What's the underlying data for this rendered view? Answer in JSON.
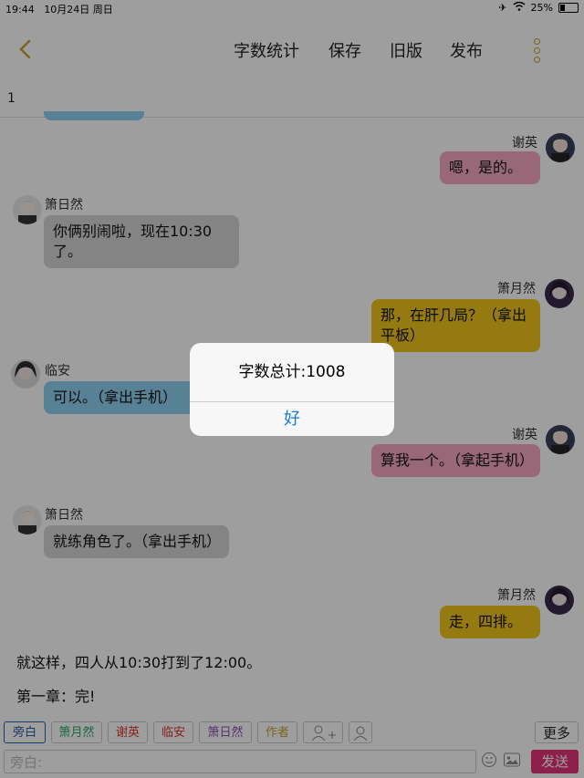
{
  "status_bar": {
    "time": "19:44",
    "date": "10月24日 周日",
    "battery": "25%",
    "battery_level": 0.25
  },
  "nav": {
    "word_count": "字数统计",
    "save": "保存",
    "old_version": "旧版",
    "publish": "发布"
  },
  "page_number": "1",
  "messages": [
    {
      "name": "谢英",
      "text": "嗯，是的。",
      "side": "right",
      "color": "#f5a8c2"
    },
    {
      "name": "箫日然",
      "text": "你俩别闹啦，现在10:30了。",
      "side": "left",
      "color": "#d6d6d6"
    },
    {
      "name": "箫月然",
      "text": "那，在肝几局？（拿出平板）",
      "side": "right",
      "color": "#f0c51c"
    },
    {
      "name": "临安",
      "text": "可以。（拿出手机）",
      "side": "left",
      "color": "#8fd0f2"
    },
    {
      "name": "谢英",
      "text": "算我一个。（拿起手机）",
      "side": "right",
      "color": "#f5a8c2"
    },
    {
      "name": "箫日然",
      "text": "就练角色了。（拿出手机）",
      "side": "left",
      "color": "#d6d6d6"
    },
    {
      "name": "箫月然",
      "text": "走，四排。",
      "side": "right",
      "color": "#f0c51c"
    }
  ],
  "narration": [
    "就这样，四人从10:30打到了12:00。",
    "第一章：完!"
  ],
  "characters": [
    {
      "label": "旁白",
      "color": "#2a5db0"
    },
    {
      "label": "箫月然",
      "color": "#2aa66b"
    },
    {
      "label": "谢英",
      "color": "#d9342b"
    },
    {
      "label": "临安",
      "color": "#d9342b"
    },
    {
      "label": "箫日然",
      "color": "#8a4fb0"
    },
    {
      "label": "作者",
      "color": "#c9a22e"
    }
  ],
  "toolbar": {
    "more": "更多",
    "send": "发送",
    "input_placeholder": "旁白:"
  },
  "dialog": {
    "message": "字数总计:1008",
    "ok": "好"
  }
}
